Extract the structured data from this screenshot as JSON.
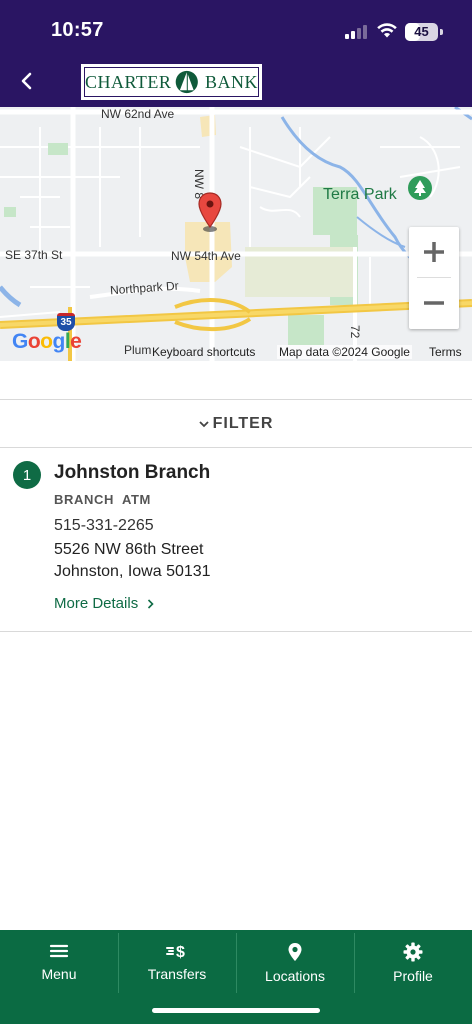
{
  "status_bar": {
    "time": "10:57",
    "battery": "45",
    "battery_level": 0.45
  },
  "header": {
    "brand_left": "CHARTER",
    "brand_right": "BANK",
    "back_icon": "chevron-left-icon",
    "background_color": "#2a1563"
  },
  "map": {
    "labels": {
      "nw_62nd": "NW 62nd Ave",
      "nw_86": "NW 8",
      "se_37th": "SE 37th St",
      "nw_54th": "NW 54th Ave",
      "northpark": "Northpark Dr",
      "plum": "Plum",
      "interstate": "35",
      "nw_72": "72",
      "park": "Terra Park"
    },
    "google": "Google",
    "footer": {
      "shortcuts": "Keyboard shortcuts",
      "data": "Map data ©2024 Google",
      "terms": "Terms"
    },
    "zoom_in": "+",
    "zoom_out": "−"
  },
  "filter": {
    "label": "FILTER",
    "icon": "chevron-down-icon"
  },
  "results": [
    {
      "rank": "1",
      "name": "Johnston Branch",
      "tags": [
        "BRANCH",
        "ATM"
      ],
      "phone": "515-331-2265",
      "address_line1": "5526 NW 86th Street",
      "address_line2": "Johnston, Iowa 50131",
      "details_link": "More Details"
    }
  ],
  "bottom_nav": {
    "items": [
      {
        "label": "Menu",
        "icon": "hamburger-menu-icon"
      },
      {
        "label": "Transfers",
        "icon": "transfer-dollar-icon"
      },
      {
        "label": "Locations",
        "icon": "location-pin-icon"
      },
      {
        "label": "Profile",
        "icon": "gear-icon"
      }
    ],
    "background_color": "#0b6b43"
  },
  "colors": {
    "accent_green": "#0f6b45",
    "header_purple": "#2a1563"
  }
}
